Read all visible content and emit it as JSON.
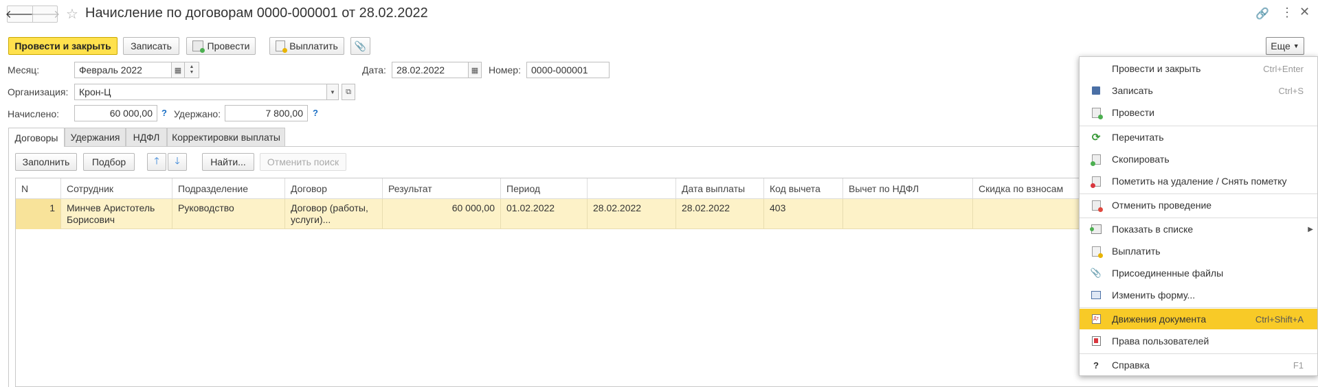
{
  "title": "Начисление по договорам 0000-000001 от 28.02.2022",
  "toolbar": {
    "post_close": "Провести и закрыть",
    "save": "Записать",
    "post": "Провести",
    "pay": "Выплатить",
    "more": "Еще"
  },
  "form": {
    "month_label": "Месяц:",
    "month_value": "Февраль 2022",
    "date_label": "Дата:",
    "date_value": "28.02.2022",
    "number_label": "Номер:",
    "number_value": "0000-000001",
    "org_label": "Организация:",
    "org_value": "Крон-Ц",
    "accrued_label": "Начислено:",
    "accrued_value": "60 000,00",
    "withheld_label": "Удержано:",
    "withheld_value": "7 800,00",
    "help_mark": "?"
  },
  "tabs": [
    "Договоры",
    "Удержания",
    "НДФЛ",
    "Корректировки выплаты"
  ],
  "table_toolbar": {
    "fill": "Заполнить",
    "pick": "Подбор",
    "find": "Найти...",
    "cancel_search": "Отменить поиск"
  },
  "table": {
    "headers": [
      "N",
      "Сотрудник",
      "Подразделение",
      "Договор",
      "Результат",
      "Период",
      "",
      "Дата выплаты",
      "Код вычета",
      "Вычет по НДФЛ",
      "Скидка по взносам"
    ],
    "rows": [
      [
        "1",
        "Минчев Аристотель Борисович",
        "Руководство",
        "Договор (работы, услуги)...",
        "60 000,00",
        "01.02.2022",
        "28.02.2022",
        "28.02.2022",
        "403",
        "",
        ""
      ]
    ]
  },
  "menu": {
    "items": [
      {
        "label": "Провести и закрыть",
        "shortcut": "Ctrl+Enter",
        "icon": "none"
      },
      {
        "label": "Записать",
        "shortcut": "Ctrl+S",
        "icon": "save-icon"
      },
      {
        "label": "Провести",
        "shortcut": "",
        "icon": "post-icon"
      },
      {
        "label": "Перечитать",
        "shortcut": "",
        "icon": "refresh-icon"
      },
      {
        "label": "Скопировать",
        "shortcut": "",
        "icon": "copy-icon"
      },
      {
        "label": "Пометить на удаление / Снять пометку",
        "shortcut": "",
        "icon": "delete-mark-icon"
      },
      {
        "label": "Отменить проведение",
        "shortcut": "",
        "icon": "unpost-icon"
      },
      {
        "label": "Показать в списке",
        "shortcut": "",
        "icon": "list-icon"
      },
      {
        "label": "Выплатить",
        "shortcut": "",
        "icon": "pay-icon"
      },
      {
        "label": "Присоединенные файлы",
        "shortcut": "",
        "icon": "paperclip-icon"
      },
      {
        "label": "Изменить форму...",
        "shortcut": "",
        "icon": "form-icon"
      },
      {
        "label": "Движения документа",
        "shortcut": "Ctrl+Shift+A",
        "icon": "movements-icon"
      },
      {
        "label": "Права пользователей",
        "shortcut": "",
        "icon": "rights-icon"
      },
      {
        "label": "Справка",
        "shortcut": "F1",
        "icon": "help-icon"
      }
    ]
  },
  "colors": {
    "accent": "#ffe14d",
    "highlight": "#f8ca27",
    "row_selected": "#fdf2c8"
  }
}
